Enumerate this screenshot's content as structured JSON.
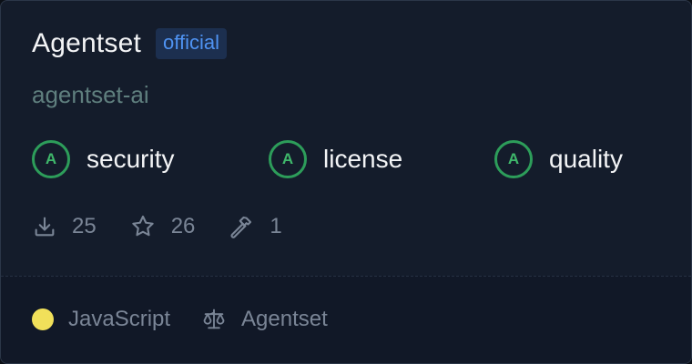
{
  "card": {
    "title": "Agentset",
    "badge": "official",
    "owner": "agentset-ai",
    "scores": [
      {
        "grade": "A",
        "label": "security",
        "icon": "grade-circle"
      },
      {
        "grade": "A",
        "label": "license",
        "icon": "grade-circle"
      },
      {
        "grade": "A",
        "label": "quality",
        "icon": "grade-circle"
      }
    ],
    "stats": {
      "downloads": "25",
      "stars": "26",
      "tools": "1"
    },
    "footer": {
      "language": "JavaScript",
      "language_color": "#f1e05a",
      "license_owner": "Agentset"
    }
  },
  "colors": {
    "background": "#141c2b",
    "footer_background": "#111827",
    "badge_background": "#1c2f4f",
    "badge_text": "#4f93f2",
    "grade_green": "#2d9d5a",
    "owner_text": "#5f7f7e",
    "muted_text": "#7a8596"
  },
  "icons": {
    "downloads": "download-icon",
    "stars": "star-icon",
    "tools": "hammer-icon",
    "license": "scale-icon"
  }
}
